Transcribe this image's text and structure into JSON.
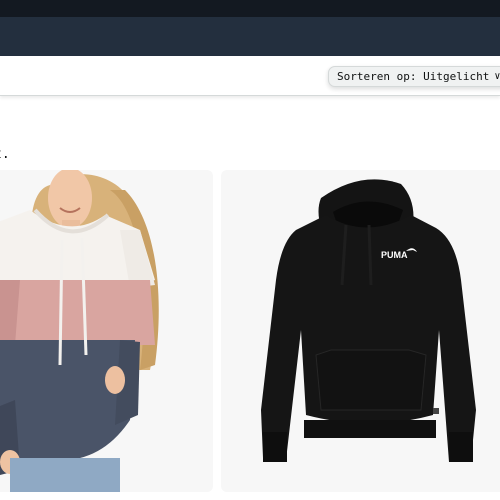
{
  "sort": {
    "label": "Sorteren op:",
    "value": "Uitgelicht"
  },
  "results": {
    "truncated_text": "t."
  },
  "products": [
    {
      "name": "colorblock-hoodie",
      "image": "color-block hoodie white pink navy"
    },
    {
      "name": "puma-hoodie",
      "image": "black hoodie",
      "logo_text": "PUMA"
    }
  ]
}
